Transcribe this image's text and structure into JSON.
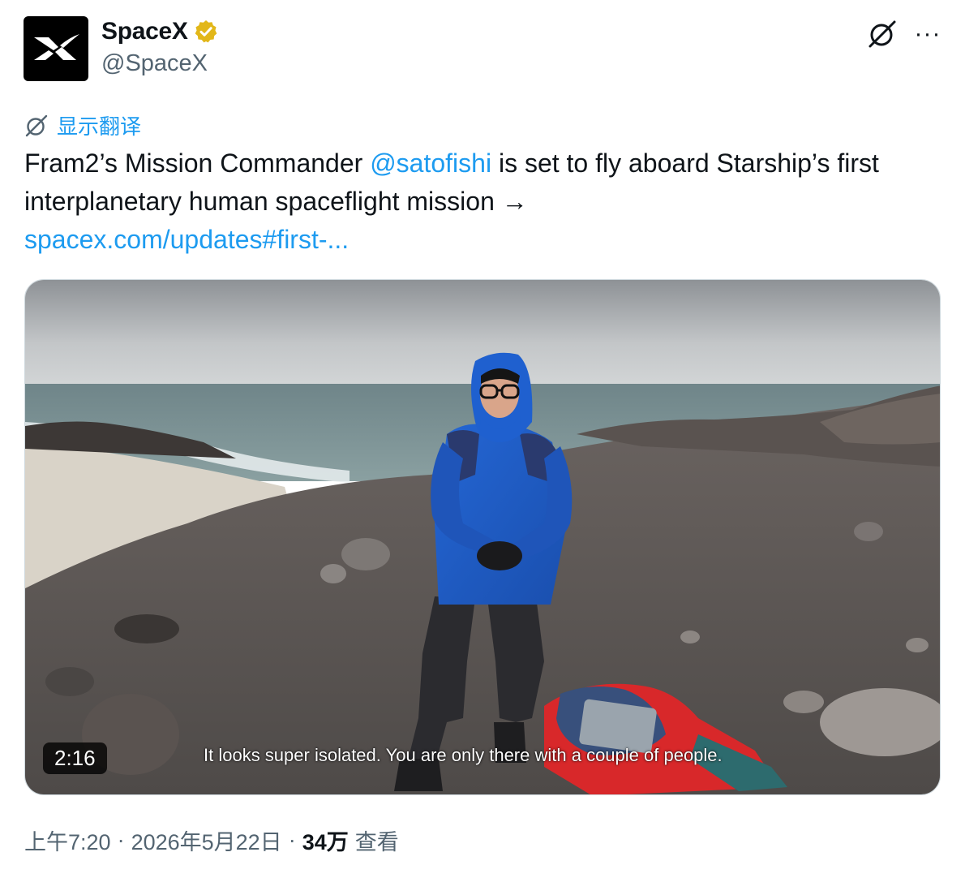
{
  "author": {
    "display_name": "SpaceX",
    "handle": "@SpaceX",
    "avatar_icon": "spacex-x-logo",
    "verified_icon": "verified-gold-badge"
  },
  "header_actions": {
    "grok_icon": "grok-icon",
    "more_label": "···"
  },
  "translate": {
    "label": "显示翻译",
    "icon": "translate-icon"
  },
  "tweet": {
    "text_part1": "Fram2’s Mission Commander ",
    "mention": "@satofishi",
    "text_part2": " is set to fly aboard Starship’s first interplanetary human spaceflight mission →",
    "link": "spacex.com/updates#first-..."
  },
  "media": {
    "duration": "2:16",
    "caption": "It looks super isolated. You are only there with a couple of people."
  },
  "footer": {
    "time": "上午7:20",
    "sep1": "·",
    "date": "2026年5月22日",
    "sep2": "·",
    "views_count": "34万",
    "views_label": "查看"
  },
  "colors": {
    "link": "#1d9bf0",
    "muted": "#536471",
    "text": "#0f1419",
    "verified": "#e2b719"
  }
}
